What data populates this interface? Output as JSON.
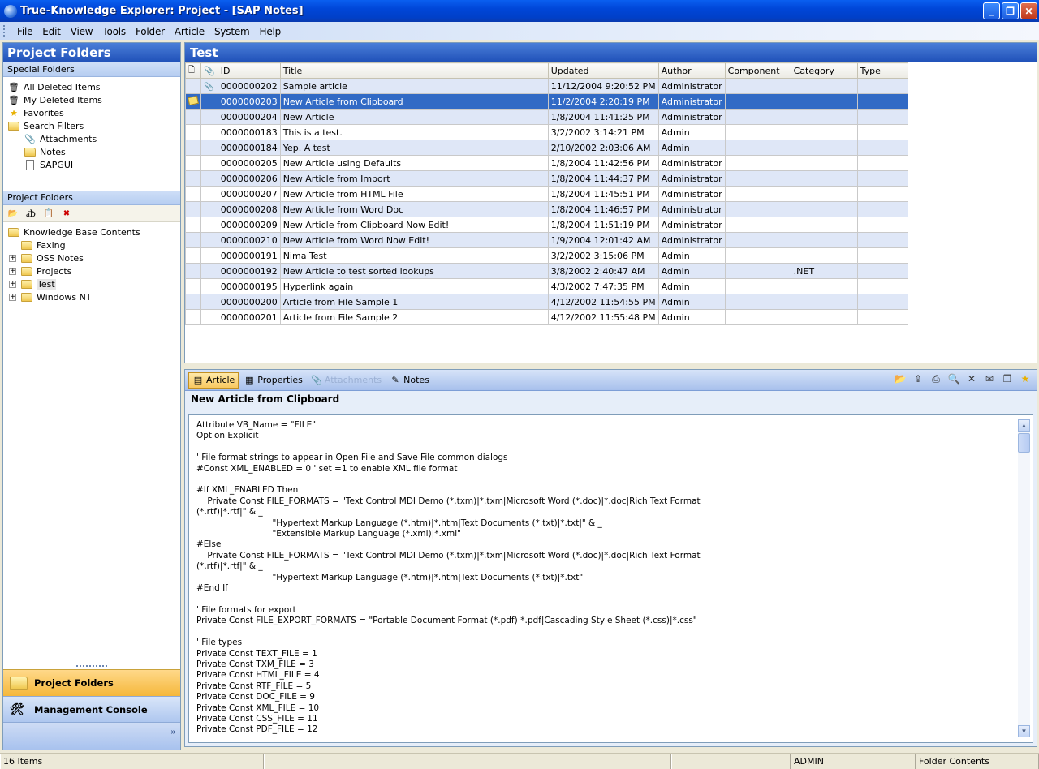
{
  "window": {
    "title": "True-Knowledge Explorer: Project - [SAP Notes]"
  },
  "menu": [
    "File",
    "Edit",
    "View",
    "Tools",
    "Folder",
    "Article",
    "System",
    "Help"
  ],
  "left": {
    "header": "Project Folders",
    "special_section": "Special Folders",
    "special_items": [
      {
        "label": "All Deleted Items",
        "icon": "recycle-bin-icon"
      },
      {
        "label": "My Deleted Items",
        "icon": "recycle-bin-icon"
      },
      {
        "label": "Favorites",
        "icon": "star-icon"
      },
      {
        "label": "Search Filters",
        "icon": "folder-open-icon"
      },
      {
        "label": "Attachments",
        "icon": "paperclip-icon"
      },
      {
        "label": "Notes",
        "icon": "folder-icon"
      },
      {
        "label": "SAPGUI",
        "icon": "document-icon"
      }
    ],
    "project_section": "Project Folders",
    "tree": [
      {
        "label": "Knowledge Base Contents",
        "expander": ""
      },
      {
        "label": "Faxing",
        "expander": ""
      },
      {
        "label": "OSS Notes",
        "expander": "+"
      },
      {
        "label": "Projects",
        "expander": "+"
      },
      {
        "label": "Test",
        "expander": "+"
      },
      {
        "label": "Windows NT",
        "expander": "+"
      }
    ],
    "nav": {
      "project_folders": "Project Folders",
      "management_console": "Management Console"
    }
  },
  "grid": {
    "header": "Test",
    "columns": [
      "ID",
      "Title",
      "Updated",
      "Author",
      "Component",
      "Category",
      "Type"
    ],
    "rows": [
      {
        "id": "0000000202",
        "title": "Sample article",
        "updated": "11/12/2004 9:20:52 PM",
        "author": "Administrator",
        "component": "",
        "category": "",
        "type": "",
        "attach": true,
        "note": false
      },
      {
        "id": "0000000203",
        "title": "New Article from Clipboard",
        "updated": "11/2/2004 2:20:19 PM",
        "author": "Administrator",
        "component": "",
        "category": "",
        "type": "",
        "attach": false,
        "note": true,
        "selected": true
      },
      {
        "id": "0000000204",
        "title": "New Article",
        "updated": "1/8/2004 11:41:25 PM",
        "author": "Administrator",
        "component": "",
        "category": "",
        "type": ""
      },
      {
        "id": "0000000183",
        "title": "This is a test.",
        "updated": "3/2/2002 3:14:21 PM",
        "author": "Admin",
        "component": "",
        "category": "",
        "type": ""
      },
      {
        "id": "0000000184",
        "title": "Yep. A test",
        "updated": "2/10/2002 2:03:06 AM",
        "author": "Admin",
        "component": "",
        "category": "",
        "type": ""
      },
      {
        "id": "0000000205",
        "title": "New Article using Defaults",
        "updated": "1/8/2004 11:42:56 PM",
        "author": "Administrator",
        "component": "",
        "category": "",
        "type": ""
      },
      {
        "id": "0000000206",
        "title": "New Article from Import",
        "updated": "1/8/2004 11:44:37 PM",
        "author": "Administrator",
        "component": "",
        "category": "",
        "type": ""
      },
      {
        "id": "0000000207",
        "title": "New Article from HTML File",
        "updated": "1/8/2004 11:45:51 PM",
        "author": "Administrator",
        "component": "",
        "category": "",
        "type": ""
      },
      {
        "id": "0000000208",
        "title": "New Article from Word Doc",
        "updated": "1/8/2004 11:46:57 PM",
        "author": "Administrator",
        "component": "",
        "category": "",
        "type": ""
      },
      {
        "id": "0000000209",
        "title": "New Article from Clipboard Now Edit!",
        "updated": "1/8/2004 11:51:19 PM",
        "author": "Administrator",
        "component": "",
        "category": "",
        "type": ""
      },
      {
        "id": "0000000210",
        "title": "New Article from Word Now Edit!",
        "updated": "1/9/2004 12:01:42 AM",
        "author": "Administrator",
        "component": "",
        "category": "",
        "type": ""
      },
      {
        "id": "0000000191",
        "title": "Nima Test",
        "updated": "3/2/2002 3:15:06 PM",
        "author": "Admin",
        "component": "",
        "category": "",
        "type": ""
      },
      {
        "id": "0000000192",
        "title": "New Article to test sorted lookups",
        "updated": "3/8/2002 2:40:47 AM",
        "author": "Admin",
        "component": "",
        "category": ".NET",
        "type": ""
      },
      {
        "id": "0000000195",
        "title": "Hyperlink again",
        "updated": "4/3/2002 7:47:35 PM",
        "author": "Admin",
        "component": "",
        "category": "",
        "type": ""
      },
      {
        "id": "0000000200",
        "title": "Article from File Sample 1",
        "updated": "4/12/2002 11:54:55 PM",
        "author": "Admin",
        "component": "",
        "category": "",
        "type": ""
      },
      {
        "id": "0000000201",
        "title": "Article from File Sample 2",
        "updated": "4/12/2002 11:55:48 PM",
        "author": "Admin",
        "component": "",
        "category": "",
        "type": ""
      }
    ]
  },
  "detail": {
    "tabs": [
      {
        "label": "Article",
        "state": "active",
        "icon": "article-icon"
      },
      {
        "label": "Properties",
        "state": "normal",
        "icon": "properties-icon"
      },
      {
        "label": "Attachments",
        "state": "disabled",
        "icon": "paperclip-icon"
      },
      {
        "label": "Notes",
        "state": "normal",
        "icon": "notes-icon"
      }
    ],
    "tools": [
      "open-icon",
      "export-icon",
      "print-icon",
      "preview-icon",
      "delete-icon",
      "email-icon",
      "copy-icon",
      "favorite-icon"
    ],
    "title": "New Article from Clipboard",
    "code": "Attribute VB_Name = \"FILE\"\nOption Explicit\n\n' File format strings to appear in Open File and Save File common dialogs\n#Const XML_ENABLED = 0 ' set =1 to enable XML file format\n\n#If XML_ENABLED Then\n    Private Const FILE_FORMATS = \"Text Control MDI Demo (*.txm)|*.txm|Microsoft Word (*.doc)|*.doc|Rich Text Format\n(*.rtf)|*.rtf|\" & _\n                            \"Hypertext Markup Language (*.htm)|*.htm|Text Documents (*.txt)|*.txt|\" & _\n                            \"Extensible Markup Language (*.xml)|*.xml\"\n#Else\n    Private Const FILE_FORMATS = \"Text Control MDI Demo (*.txm)|*.txm|Microsoft Word (*.doc)|*.doc|Rich Text Format\n(*.rtf)|*.rtf|\" & _\n                            \"Hypertext Markup Language (*.htm)|*.htm|Text Documents (*.txt)|*.txt\"\n#End If\n\n' File formats for export\nPrivate Const FILE_EXPORT_FORMATS = \"Portable Document Format (*.pdf)|*.pdf|Cascading Style Sheet (*.css)|*.css\"\n\n' File types\nPrivate Const TEXT_FILE = 1\nPrivate Const TXM_FILE = 3\nPrivate Const HTML_FILE = 4\nPrivate Const RTF_FILE = 5\nPrivate Const DOC_FILE = 9\nPrivate Const XML_FILE = 10\nPrivate Const CSS_FILE = 11\nPrivate Const PDF_FILE = 12"
  },
  "status": {
    "items": "16 Items",
    "user": "ADMIN",
    "context": "Folder Contents"
  }
}
